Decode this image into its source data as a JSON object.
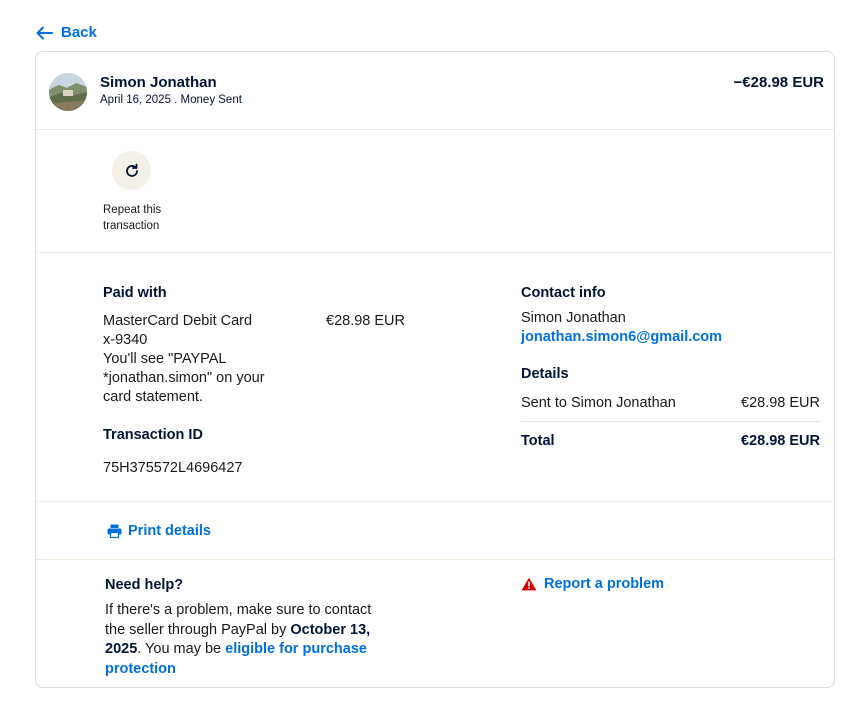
{
  "nav": {
    "back_label": "Back"
  },
  "header": {
    "name": "Simon Jonathan",
    "subtitle": "April 16, 2025 . Money Sent",
    "amount": "−€28.98 EUR"
  },
  "repeat": {
    "label": "Repeat this transaction"
  },
  "paid_with": {
    "heading": "Paid with",
    "method": "MasterCard Debit Card",
    "card_number": "x-9340",
    "amount": "€28.98 EUR",
    "statement_note": "You'll see \"PAYPAL *jonathan.simon\" on your card statement."
  },
  "transaction": {
    "heading": "Transaction ID",
    "id": "75H375572L4696427"
  },
  "contact": {
    "heading": "Contact info",
    "name": "Simon Jonathan",
    "email": "jonathan.simon6@gmail.com"
  },
  "details": {
    "heading": "Details",
    "line_label": "Sent to Simon Jonathan",
    "line_amount": "€28.98 EUR",
    "total_label": "Total",
    "total_amount": "€28.98 EUR"
  },
  "print": {
    "label": "Print details"
  },
  "help": {
    "heading": "Need help?",
    "text_1": "If there's a problem, make sure to contact the seller through PayPal by ",
    "deadline": "October 13, 2025",
    "text_2": ". You may be ",
    "protection_link": "eligible for purchase protection",
    "report_label": "Report a problem"
  },
  "colors": {
    "link": "#0070e0",
    "heading": "#001435",
    "warning": "#d20000"
  },
  "icons": [
    "arrow-left-icon",
    "refresh-icon",
    "printer-icon",
    "warning-icon"
  ]
}
